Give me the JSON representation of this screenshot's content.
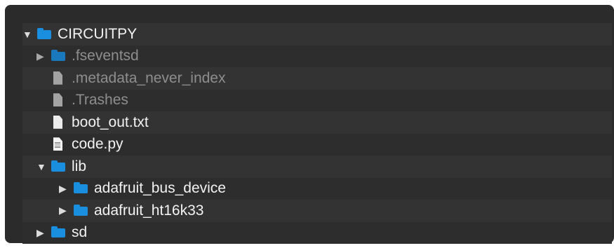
{
  "tree": {
    "rows": [
      {
        "label": "CIRCUITPY",
        "icon": "folder-icon",
        "expanded": true
      },
      {
        "label": ".fseventsd",
        "icon": "folder-icon",
        "expanded": false
      },
      {
        "label": ".metadata_never_index",
        "icon": "file-icon"
      },
      {
        "label": ".Trashes",
        "icon": "file-icon"
      },
      {
        "label": "boot_out.txt",
        "icon": "file-icon"
      },
      {
        "label": "code.py",
        "icon": "python-file-icon"
      },
      {
        "label": "lib",
        "icon": "folder-icon",
        "expanded": true
      },
      {
        "label": "adafruit_bus_device",
        "icon": "folder-icon",
        "expanded": false
      },
      {
        "label": "adafruit_ht16k33",
        "icon": "folder-icon",
        "expanded": false
      },
      {
        "label": "sd",
        "icon": "folder-icon",
        "expanded": false
      }
    ]
  },
  "colors": {
    "background": "#2b2b2b",
    "folder": "#1a8fe0",
    "text": "#f2f2f2",
    "hidden_text": "#8e8e8e"
  }
}
